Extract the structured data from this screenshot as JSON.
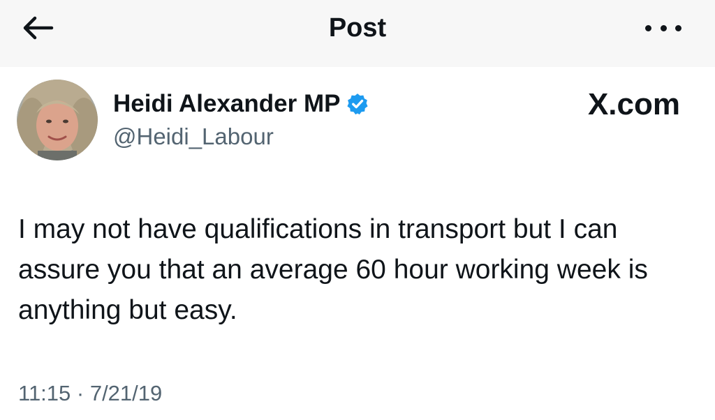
{
  "header": {
    "title": "Post",
    "back_icon": "arrow-left-icon",
    "more_icon": "more-horizontal-icon"
  },
  "author": {
    "display_name": "Heidi Alexander MP",
    "handle": "@Heidi_Labour",
    "verified_icon": "verified-badge-icon",
    "verified_color": "#1d9bf0"
  },
  "brand": {
    "label": "X.com"
  },
  "post": {
    "text": "I may not have qualifications in transport but I can assure you that an average 60 hour working week is anything but easy.",
    "timestamp": "11:15 · 7/21/19"
  },
  "colors": {
    "text_primary": "#0f1419",
    "text_secondary": "#536471",
    "header_bg": "#f7f7f7"
  }
}
